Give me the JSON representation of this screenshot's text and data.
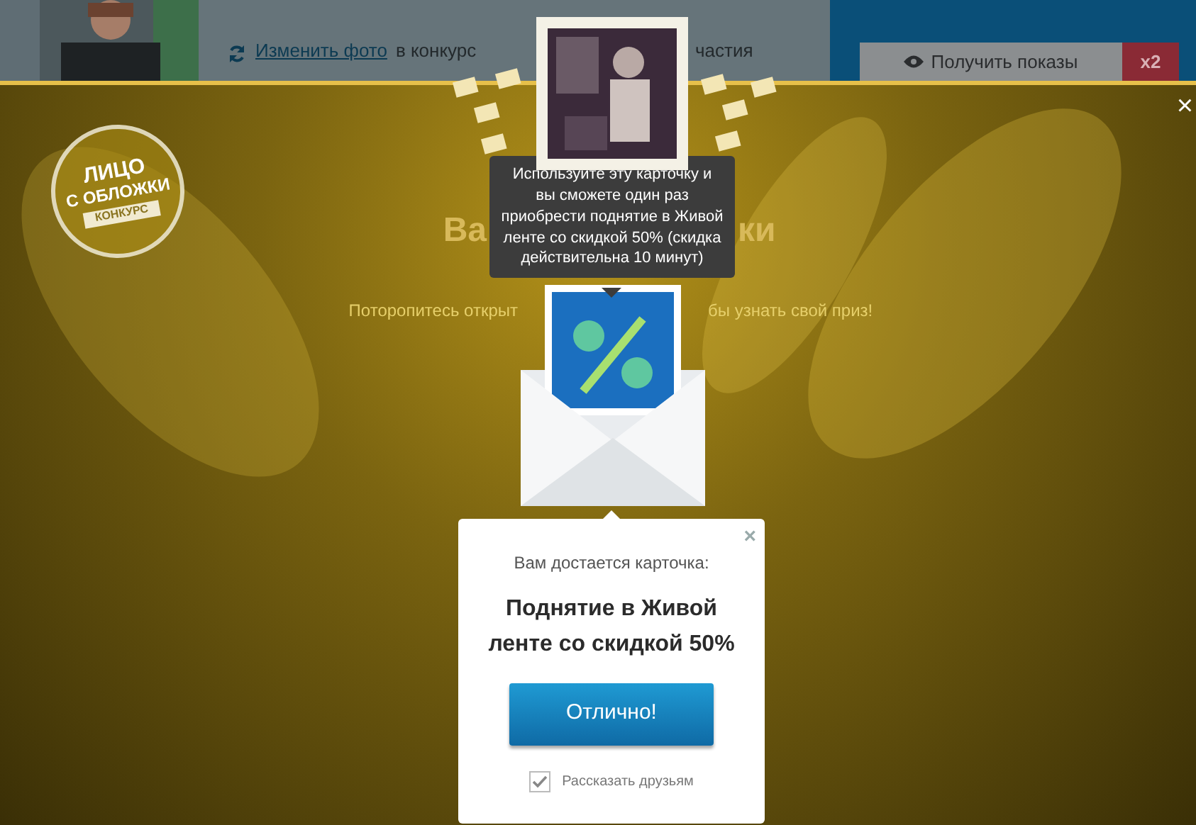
{
  "page": {
    "change_photo_link": "Изменить фото",
    "link_tail": "в конкурс",
    "text_tail": "частия",
    "show_button": "Получить показы",
    "multiplier_badge": "x2"
  },
  "overlay": {
    "close": "×",
    "logo_lines": [
      "ЛИЦО",
      "С ОБЛОЖКИ"
    ],
    "logo_ribbon": "КОНКУРС",
    "title_left": "Ва",
    "title_right": "ки",
    "hint_left": "Поторопитесь открыт",
    "hint_right": "бы узнать свой приз!",
    "tooltip": "Используйте эту карточку и вы сможете один раз приобрести поднятие в Живой ленте со скидкой 50% (скидка действительна 10 минут)"
  },
  "popup": {
    "close": "×",
    "intro": "Вам достается карточка:",
    "prize": "Поднятие в Живой ленте со скидкой 50%",
    "button": "Отлично!",
    "share_label": "Рассказать друзьям",
    "share_checked": true
  }
}
